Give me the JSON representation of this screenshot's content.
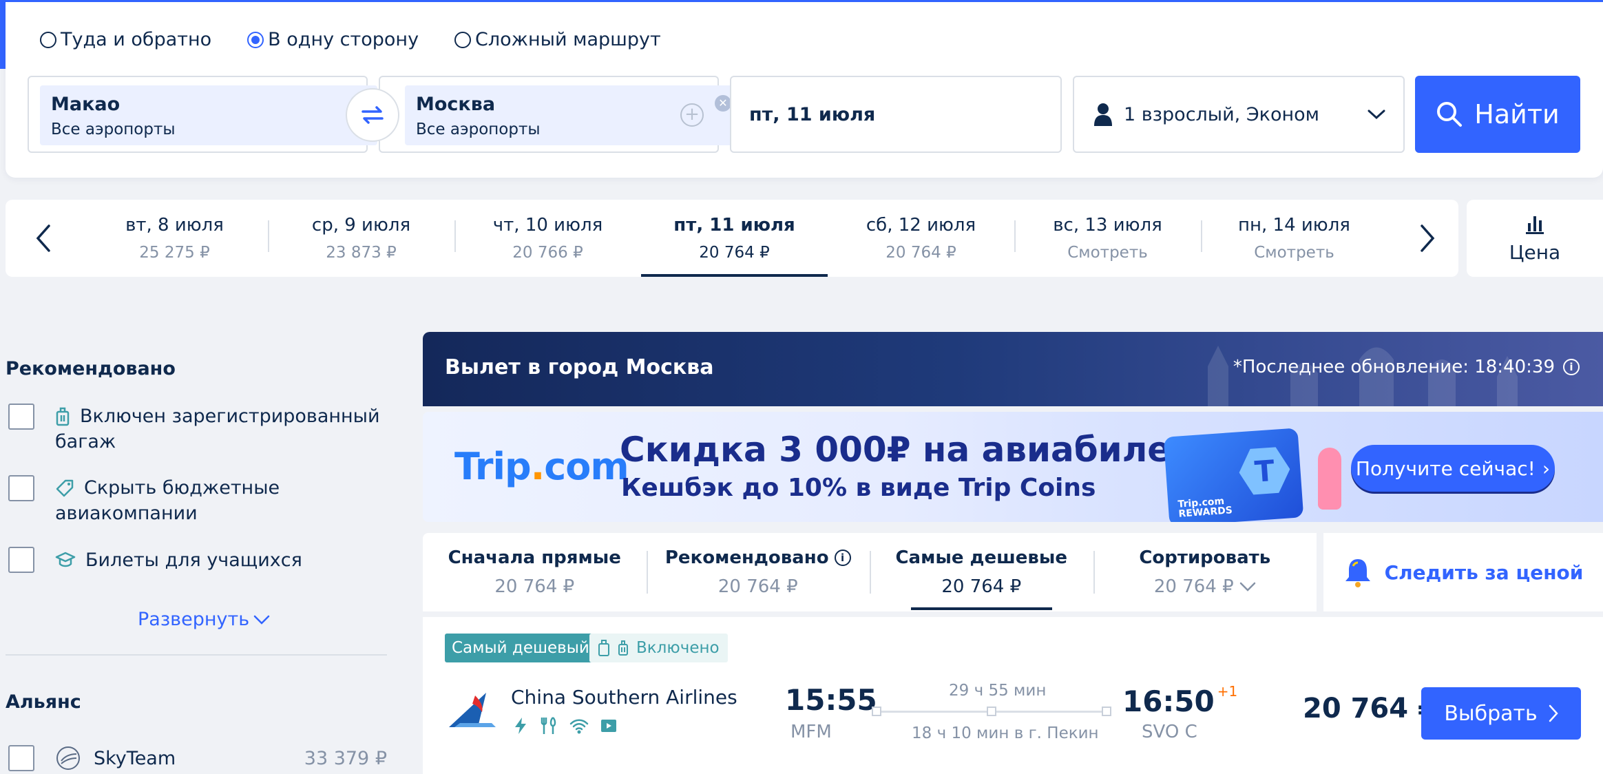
{
  "search": {
    "trip_types": [
      {
        "label": "Туда и обратно",
        "checked": false
      },
      {
        "label": "В одну сторону",
        "checked": true
      },
      {
        "label": "Сложный маршрут",
        "checked": false
      }
    ],
    "from": {
      "city": "Макао",
      "sub": "Все аэропорты"
    },
    "to": {
      "city": "Москва",
      "sub": "Все аэропорты"
    },
    "date": "пт, 11 июля",
    "passengers": "1 взрослый, Эконом",
    "search_button": "Найти"
  },
  "date_strip": {
    "dates": [
      {
        "day": "вт, 8 июля",
        "price": "25 275 ₽",
        "active": false
      },
      {
        "day": "ср, 9 июля",
        "price": "23 873 ₽",
        "active": false
      },
      {
        "day": "чт, 10 июля",
        "price": "20 766 ₽",
        "active": false
      },
      {
        "day": "пт, 11 июля",
        "price": "20 764 ₽",
        "active": true
      },
      {
        "day": "сб, 12 июля",
        "price": "20 764 ₽",
        "active": false
      },
      {
        "day": "вс, 13 июля",
        "price": "Смотреть",
        "active": false
      },
      {
        "day": "пн, 14 июля",
        "price": "Смотреть",
        "active": false
      }
    ],
    "price_toggle": "Цена"
  },
  "filters": {
    "recommended_title": "Рекомендовано",
    "options": [
      {
        "label_line1": "Включен зарегистрированный",
        "label_line2": "багаж",
        "icon": "luggage-icon"
      },
      {
        "label_line1": "Скрыть бюджетные",
        "label_line2": "авиакомпании",
        "icon": "tag-icon"
      },
      {
        "label_line1": "Билеты для учащихся",
        "label_line2": "",
        "icon": "graduation-cap-icon"
      }
    ],
    "expand": "Развернуть",
    "alliance_title": "Альянс",
    "alliances": [
      {
        "name": "SkyTeam",
        "price": "33 379 ₽"
      }
    ]
  },
  "results": {
    "header_title": "Вылет в город Москва",
    "updated": "*Последнее обновление: 18:40:39",
    "banner": {
      "logo_main": "Trip",
      "logo_dot": ".",
      "logo_tail": "com",
      "headline": "Скидка 3 000₽ на авиабилеты",
      "subline": "Кешбэк до 10% в виде Trip Coins",
      "card_text_1": "Trip.com",
      "card_text_2": "REWARDS",
      "card_letter": "T",
      "cta": "Получите сейчас!"
    },
    "sort": [
      {
        "label": "Сначала прямые",
        "value": "20 764 ₽",
        "active": false
      },
      {
        "label": "Рекомендовано",
        "value": "20 764 ₽",
        "active": false
      },
      {
        "label": "Самые дешевые",
        "value": "20 764 ₽",
        "active": true
      },
      {
        "label": "Сортировать",
        "value": "20 764 ₽",
        "active": false
      }
    ],
    "watch_price": "Следить за ценой",
    "flight": {
      "badge_cheapest": "Самый дешевый",
      "badge_included": "Включено",
      "airline": "China Southern Airlines",
      "dep_time": "15:55",
      "dep_code": "MFM",
      "duration": "29 ч 55 мин",
      "stopover": "18 ч 10 мин в г. Пекин",
      "arr_time": "16:50",
      "arr_day_offset": "+1",
      "arr_code": "SVO C",
      "price": "20 764 ₽",
      "choose": "Выбрать"
    }
  },
  "colors": {
    "brand_blue": "#3264ff",
    "text_dark": "#0f294d",
    "muted": "#8592a6",
    "teal_badge": "#3d9ea8",
    "day_offset": "#ff6f00"
  }
}
